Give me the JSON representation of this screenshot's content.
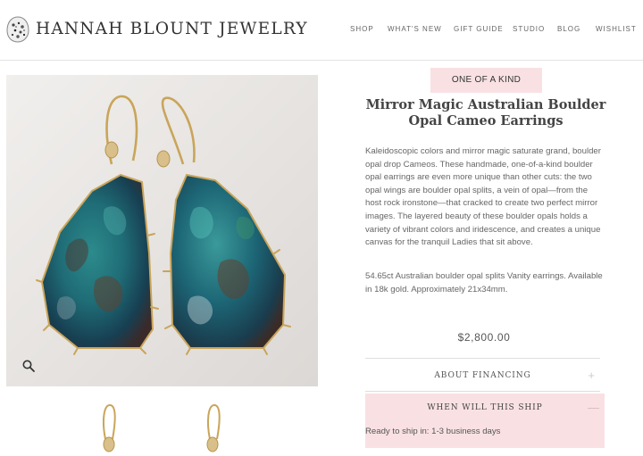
{
  "header": {
    "brand": "HANNAH BLOUNT JEWELRY",
    "nav": [
      "SHOP",
      "WHAT'S NEW",
      "GIFT GUIDE",
      "STUDIO",
      "BLOG",
      "WISHLIST"
    ]
  },
  "product": {
    "badge": "ONE OF A KIND",
    "title": "Mirror Magic Australian Boulder Opal Cameo Earrings",
    "description": "Kaleidoscopic colors and mirror magic saturate grand, boulder opal drop Cameos. These handmade, one-of-a-kind boulder opal earrings are even more unique than other cuts: the two opal wings are boulder opal splits, a vein of opal—from the host rock ironstone—that cracked to create two perfect mirror images. The layered beauty of these boulder opals holds a variety of vibrant colors and iridescence, and creates a unique canvas for the tranquil Ladies that sit above.",
    "specs": "54.65ct Australian boulder opal splits Vanity earrings. Available in 18k gold. Approximately 21x34mm.",
    "price": "$2,800.00"
  },
  "accordion": [
    {
      "label": "ABOUT FINANCING",
      "icon": "+",
      "expanded": false
    },
    {
      "label": "WHEN WILL THIS SHIP",
      "icon": "—",
      "expanded": true,
      "body": "Ready to ship in: 1-3 business days"
    }
  ],
  "icons": {
    "logo": "opal-stone-logo-icon",
    "zoom": "magnifier-icon",
    "accordion_collapsed": "plus-icon",
    "accordion_expanded": "minus-icon"
  },
  "colors": {
    "accent_pink": "#f9e1e3",
    "gold": "#c9a55a",
    "opal_teal": "#1c6d73"
  }
}
